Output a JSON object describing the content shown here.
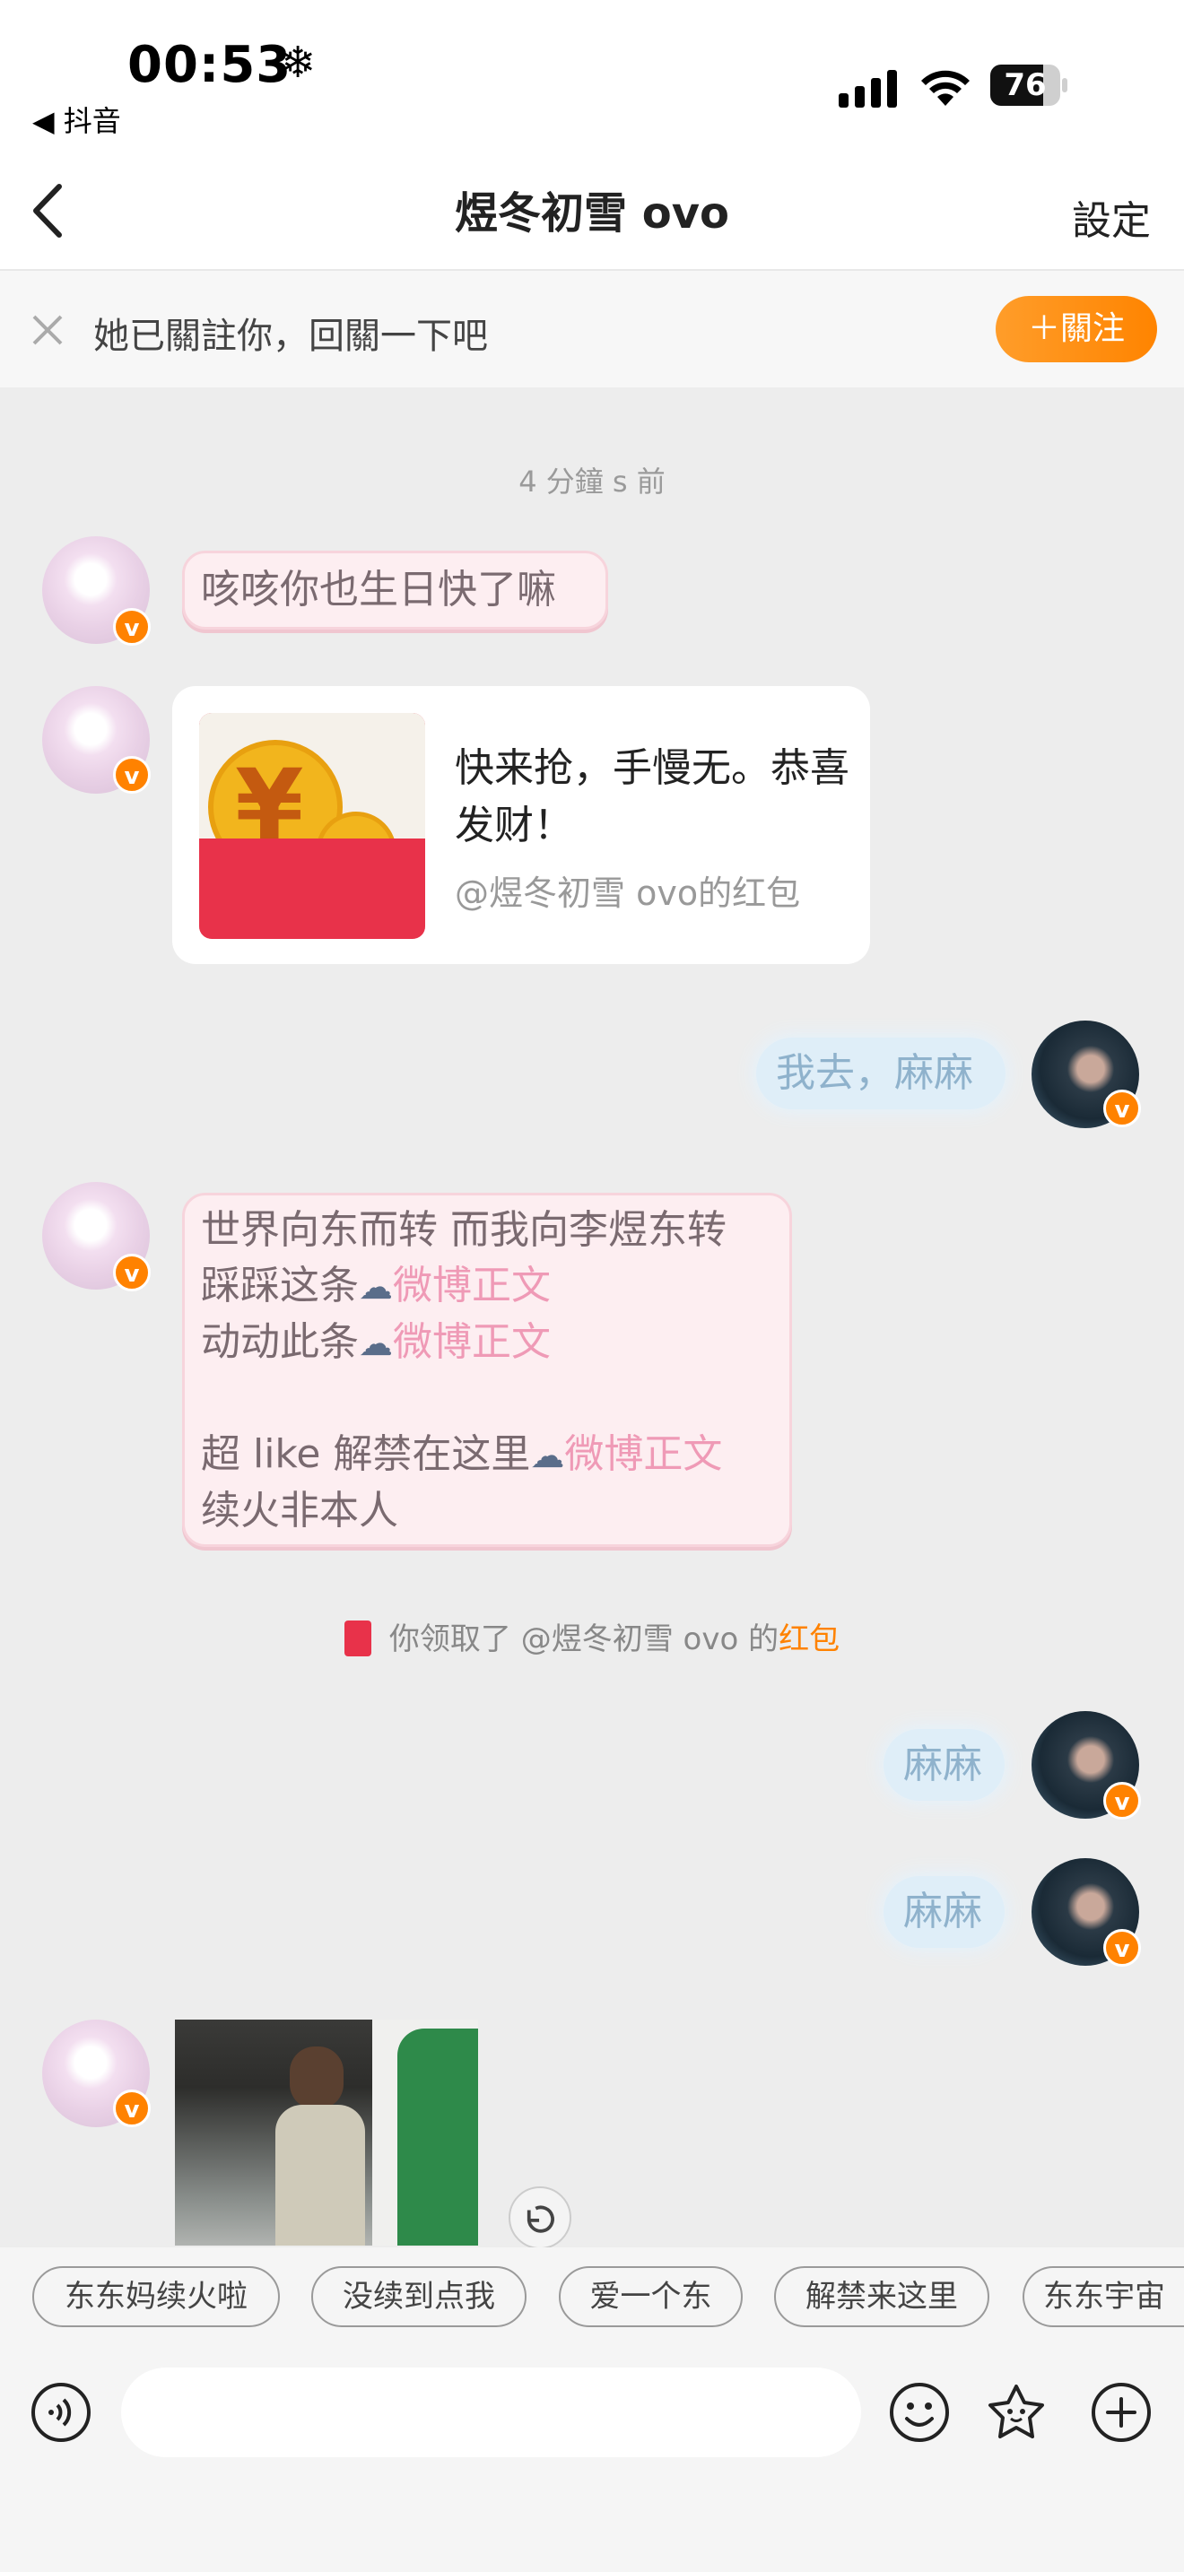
{
  "status_bar": {
    "time": "00:53",
    "weather_icon": "snowflake-icon",
    "back_app": "◀ 抖音",
    "battery": "76"
  },
  "nav": {
    "title": "煜冬初雪 ovo",
    "settings": "設定"
  },
  "follow_banner": {
    "text": "她已關註你，回關一下吧",
    "button": "＋關注"
  },
  "timestamp": "4 分鐘 s 前",
  "messages": {
    "m1": "咳咳你也生日快了嘛",
    "redpacket": {
      "title": "快来抢，手慢无。恭喜发财！",
      "from": "@煜冬初雪 ovo的红包"
    },
    "m3": "我去，麻麻",
    "m4": {
      "line1": "世界向东而转 而我向李煜东转",
      "line2": "踩踩这条",
      "line3": "动动此条",
      "line5": "超 like 解禁在这里",
      "line6": "续火非本人",
      "link": "微博正文"
    },
    "system": {
      "prefix": "你领取了 @煜冬初雪 ovo 的",
      "highlight": "红包"
    },
    "m6": "麻麻",
    "m7": "麻麻"
  },
  "quick_replies": [
    "东东妈续火啦",
    "没续到点我",
    "爱一个东",
    "解禁来这里",
    "东东宇宙"
  ],
  "colors": {
    "accent": "#ff8200",
    "pink_bubble": "#fdeef1",
    "blue_bubble": "#dfeef8",
    "red_packet": "#e8324a"
  }
}
